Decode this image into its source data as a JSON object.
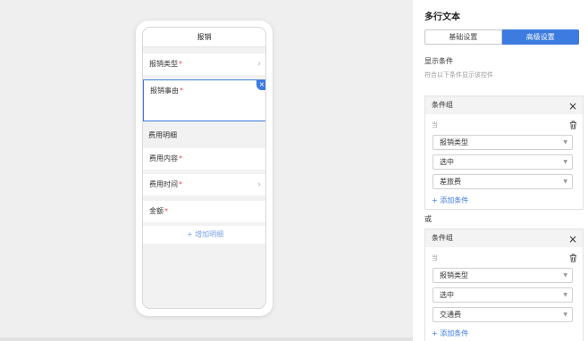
{
  "phone": {
    "title": "报销",
    "fields": {
      "type_label": "报销类型",
      "reason_label": "报销事由",
      "section_label": "费用明细",
      "content_label": "费用内容",
      "time_label": "费用时间",
      "amount_label": "金额",
      "required_mark": "*",
      "chevron": "›",
      "close": "×"
    },
    "add_detail": "+ 增加明细"
  },
  "panel": {
    "title": "多行文本",
    "tabs": [
      "基础设置",
      "高级设置"
    ],
    "active_tab": "高级设置",
    "show_condition": "显示条件",
    "show_hint": "符合以下条件显示该控件",
    "or_label": "或",
    "groups": [
      {
        "title": "条件组",
        "when": "当",
        "selects": [
          "报销类型",
          "选中",
          "差旅费"
        ],
        "add_condition": "+ 添加条件"
      },
      {
        "title": "条件组",
        "when": "当",
        "selects": [
          "报销类型",
          "选中",
          "交通费"
        ],
        "add_condition": "+ 添加条件"
      }
    ]
  },
  "icons": {
    "close_icon": "×",
    "dropdown_icon": "▼"
  },
  "colors": {
    "accent": "#3d7be0",
    "required": "#e34d59",
    "link_light": "#7ca3e6"
  }
}
